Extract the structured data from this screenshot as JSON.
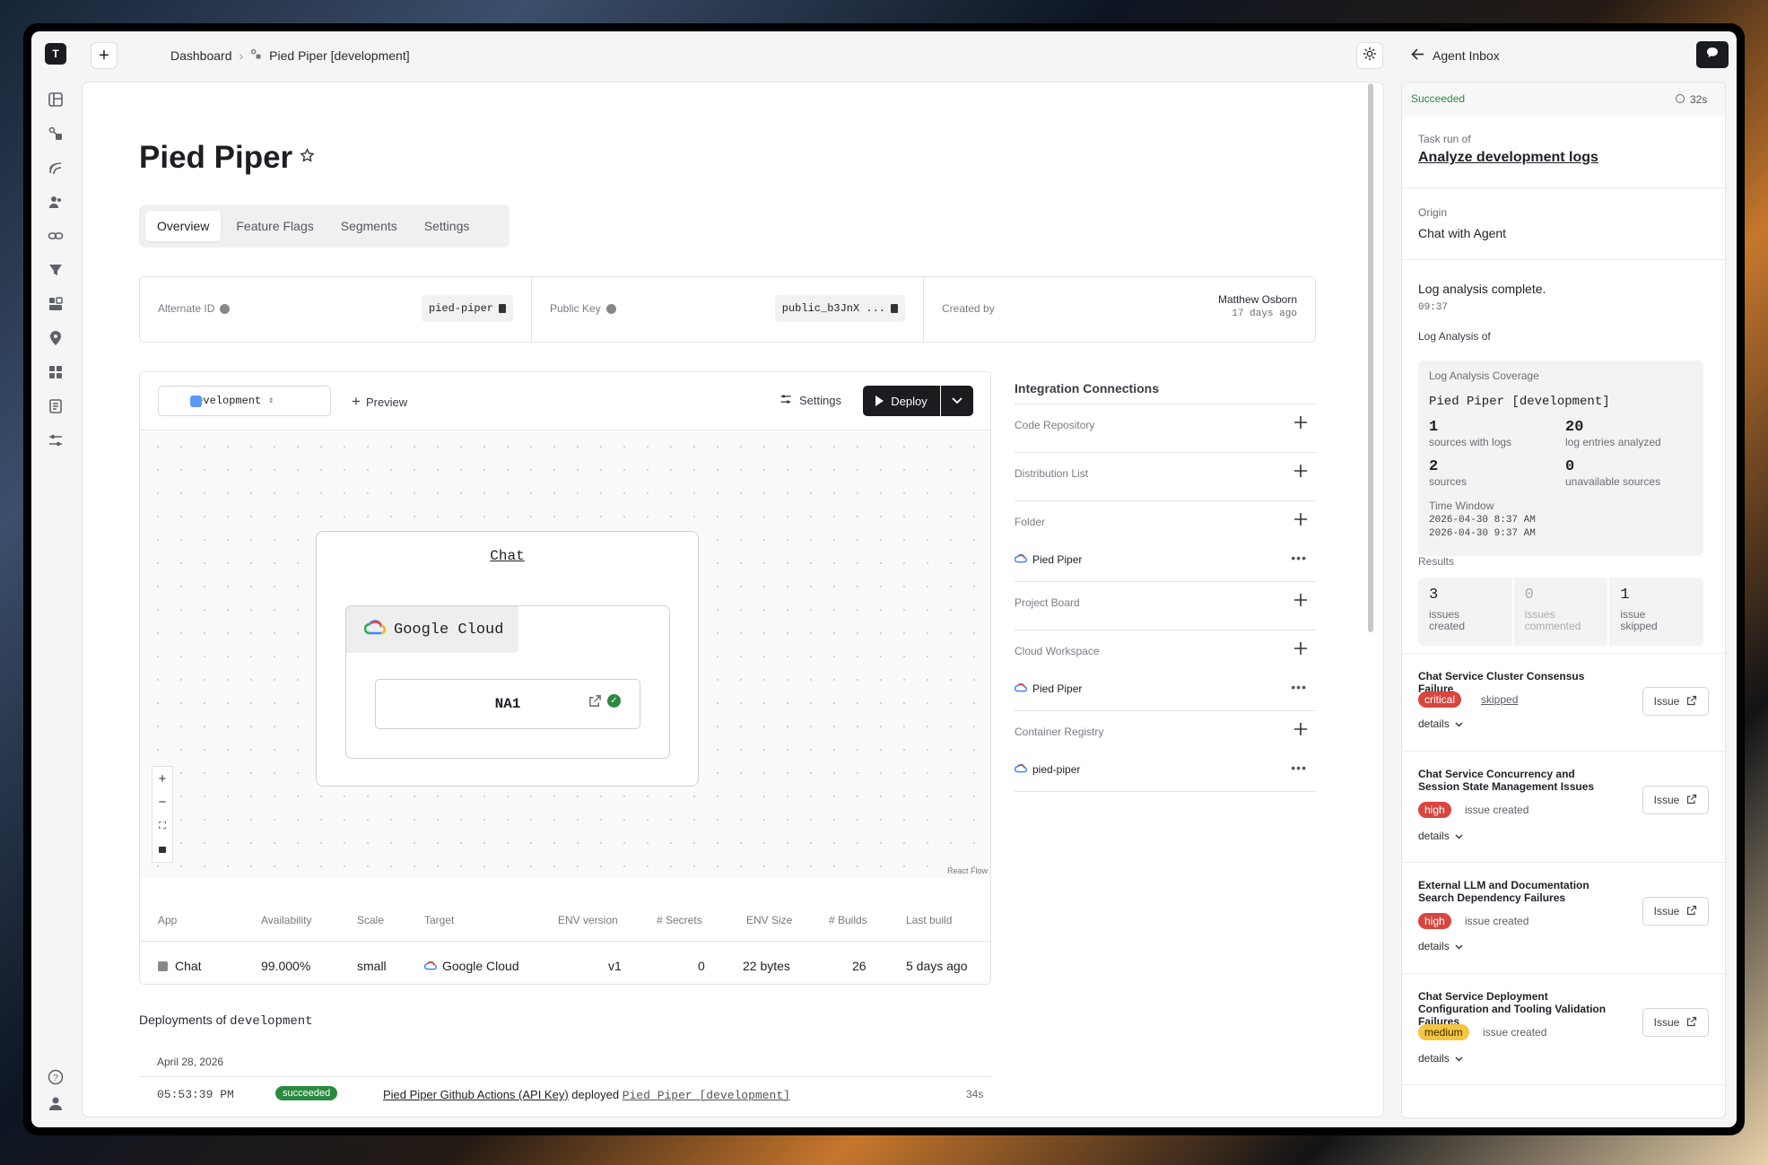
{
  "rail": {
    "logo": "T",
    "icons": [
      "dashboard-icon",
      "apps-icon",
      "routes-icon",
      "users-icon",
      "links-icon",
      "funnel-icon",
      "builds-icon",
      "location-icon",
      "grid-icon",
      "docs-icon",
      "sliders-icon"
    ],
    "bottom_icons": [
      "help-icon",
      "profile-icon"
    ]
  },
  "topbar": {
    "crumb_root": "Dashboard",
    "crumb_current": "Pied Piper [development]"
  },
  "page": {
    "title": "Pied Piper",
    "tabs": [
      "Overview",
      "Feature Flags",
      "Segments",
      "Settings"
    ],
    "active_tab": "Overview",
    "info": {
      "alt_id_label": "Alternate ID",
      "alt_id_value": "pied-piper",
      "pubkey_label": "Public Key",
      "pubkey_value": "public_b3JnX ...",
      "created_label": "Created by",
      "created_name": "Matthew Osborn",
      "created_ago": "17 days ago"
    }
  },
  "flow": {
    "env": "development",
    "preview": "Preview",
    "settings": "Settings",
    "deploy": "Deploy",
    "group_label": "Chat",
    "cloud": "Google Cloud",
    "node": "NA1",
    "attribution": "React Flow"
  },
  "apptable": {
    "headers": {
      "app": "App",
      "availability": "Availability",
      "scale": "Scale",
      "target": "Target",
      "env_version": "ENV version",
      "secrets": "# Secrets",
      "env_size": "ENV Size",
      "builds": "# Builds",
      "last_build": "Last build"
    },
    "row": {
      "app": "Chat",
      "availability": "99.000%",
      "scale": "small",
      "target": "Google Cloud",
      "env_version": "v1",
      "secrets": "0",
      "env_size": "22 bytes",
      "builds": "26",
      "last_build": "5 days ago"
    }
  },
  "integrations": {
    "title": "Integration Connections",
    "sections": [
      {
        "name": "Code Repository",
        "items": []
      },
      {
        "name": "Distribution List",
        "items": []
      },
      {
        "name": "Folder",
        "items": [
          "Pied Piper"
        ]
      },
      {
        "name": "Project Board",
        "items": []
      },
      {
        "name": "Cloud Workspace",
        "items": [
          "Pied Piper"
        ]
      },
      {
        "name": "Container Registry",
        "items": [
          "pied-piper"
        ]
      }
    ]
  },
  "deployments": {
    "title_prefix": "Deployments of",
    "env": "development",
    "date": "April 28, 2026",
    "row": {
      "time": "05:53:39 PM",
      "status": "succeeded",
      "actor": "Pied Piper Github Actions (API Key)",
      "verb": "deployed",
      "target": "Pied Piper [development]",
      "duration": "34s"
    }
  },
  "inbox": {
    "title": "Agent Inbox",
    "status": "Succeeded",
    "elapsed": "32s",
    "task_label": "Task run of",
    "task_name": "Analyze development logs",
    "origin_label": "Origin",
    "origin_value": "Chat with Agent",
    "summary": "Log analysis complete.",
    "summary_time": "09:37",
    "analysis_of": "Log Analysis of",
    "coverage": {
      "title": "Log Analysis Coverage",
      "subject": "Pied Piper [development]",
      "stats": [
        {
          "num": "1",
          "label": "sources with logs"
        },
        {
          "num": "20",
          "label": "log entries analyzed"
        },
        {
          "num": "2",
          "label": "sources"
        },
        {
          "num": "0",
          "label": "unavailable sources"
        }
      ],
      "window_label": "Time Window",
      "window_start": "2026-04-30 8:37 AM",
      "window_end": "2026-04-30 9:37 AM"
    },
    "results_label": "Results",
    "results": [
      {
        "num": "3",
        "label1": "issues",
        "label2": "created"
      },
      {
        "num": "0",
        "label1": "issues",
        "label2": "commented"
      },
      {
        "num": "1",
        "label1": "issue",
        "label2": "skipped"
      }
    ],
    "issues": [
      {
        "title": "Chat Service Cluster Consensus Failure",
        "severity": "critical",
        "status": "skipped",
        "details": "details",
        "button": "Issue"
      },
      {
        "title": "Chat Service Concurrency and Session State Management Issues",
        "severity": "high",
        "status": "issue created",
        "details": "details",
        "button": "Issue"
      },
      {
        "title": "External LLM and Documentation Search Dependency Failures",
        "severity": "high",
        "status": "issue created",
        "details": "details",
        "button": "Issue"
      },
      {
        "title": "Chat Service Deployment Configuration and Tooling Validation Failures",
        "severity": "medium",
        "status": "issue created",
        "details": "details",
        "button": "Issue"
      }
    ]
  },
  "colors": {
    "accent": "#1b1c1f",
    "success": "#2a8a3f",
    "critical": "#d9453f",
    "medium": "#f4c542",
    "env_swatch": "#5a9cf5"
  }
}
